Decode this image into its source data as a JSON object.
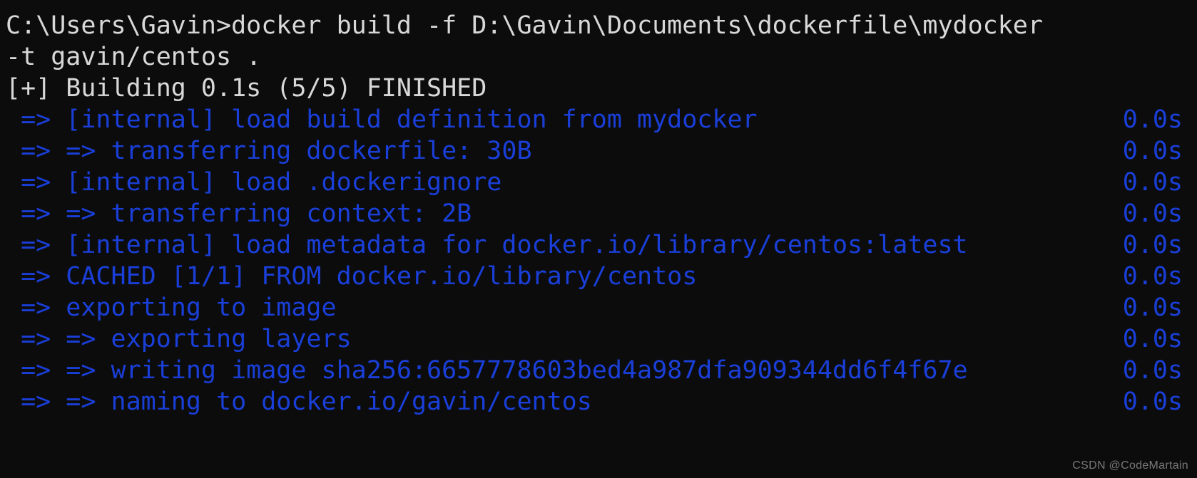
{
  "terminal": {
    "background_color": "#0c0c0c",
    "prompt_color": "#d8d8d8",
    "step_color": "#1a3fd9",
    "command_lines": [
      "C:\\Users\\Gavin>docker build -f D:\\Gavin\\Documents\\dockerfile\\mydocker",
      "-t gavin/centos .",
      "[+] Building 0.1s (5/5) FINISHED"
    ],
    "build_steps": [
      {
        "text": " => [internal] load build definition from mydocker",
        "time": "0.0s"
      },
      {
        "text": " => => transferring dockerfile: 30B",
        "time": "0.0s"
      },
      {
        "text": " => [internal] load .dockerignore",
        "time": "0.0s"
      },
      {
        "text": " => => transferring context: 2B",
        "time": "0.0s"
      },
      {
        "text": " => [internal] load metadata for docker.io/library/centos:latest",
        "time": "0.0s"
      },
      {
        "text": " => CACHED [1/1] FROM docker.io/library/centos",
        "time": "0.0s"
      },
      {
        "text": " => exporting to image",
        "time": "0.0s"
      },
      {
        "text": " => => exporting layers",
        "time": "0.0s"
      },
      {
        "text": " => => writing image sha256:6657778603bed4a987dfa909344dd6f4f67e",
        "time": "0.0s"
      },
      {
        "text": " => => naming to docker.io/gavin/centos",
        "time": "0.0s"
      }
    ],
    "watermark": "CSDN @CodeMartain"
  }
}
